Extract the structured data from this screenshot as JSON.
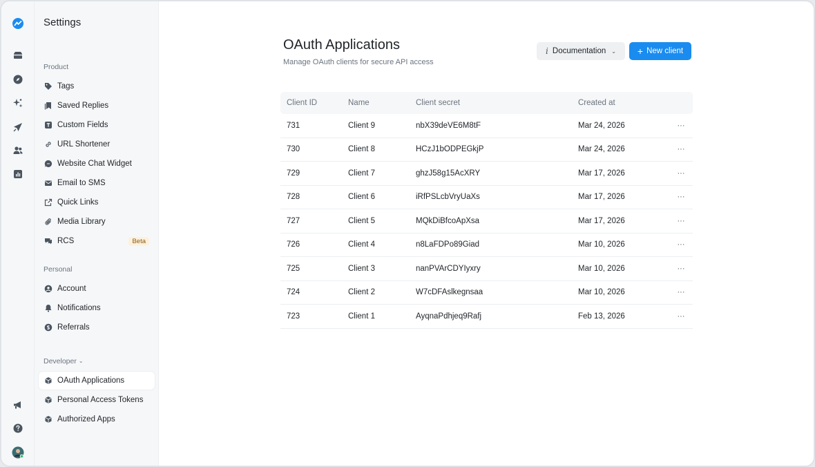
{
  "sidebar": {
    "title": "Settings",
    "sections": {
      "product": "Product",
      "personal": "Personal",
      "developer": "Developer"
    },
    "items": {
      "tags": "Tags",
      "saved_replies": "Saved Replies",
      "custom_fields": "Custom Fields",
      "url_shortener": "URL Shortener",
      "website_chat_widget": "Website Chat Widget",
      "email_to_sms": "Email to SMS",
      "quick_links": "Quick Links",
      "media_library": "Media Library",
      "rcs": "RCS",
      "rcs_badge": "Beta",
      "account": "Account",
      "notifications": "Notifications",
      "referrals": "Referrals",
      "oauth_applications": "OAuth Applications",
      "personal_access_tokens": "Personal Access Tokens",
      "authorized_apps": "Authorized Apps"
    },
    "active_item": "oauth_applications"
  },
  "rail": {
    "icons": [
      "logo-icon",
      "inbox-icon",
      "compass-icon",
      "sparkles-icon",
      "send-icon",
      "contacts-icon",
      "analytics-icon",
      "megaphone-icon",
      "help-icon",
      "avatar"
    ]
  },
  "header": {
    "title": "OAuth Applications",
    "subtitle": "Manage OAuth clients for secure API access",
    "doc_button": "Documentation",
    "new_button": "New client"
  },
  "table": {
    "columns": {
      "id": "Client ID",
      "name": "Name",
      "secret": "Client secret",
      "created": "Created at"
    },
    "rows": [
      {
        "id": "731",
        "name": "Client 9",
        "secret": "nbX39deVE6M8tF",
        "created": "Mar 24, 2026"
      },
      {
        "id": "730",
        "name": "Client 8",
        "secret": "HCzJ1bODPEGkjP",
        "created": "Mar 24, 2026"
      },
      {
        "id": "729",
        "name": "Client 7",
        "secret": "ghzJ58g15AcXRY",
        "created": "Mar 17, 2026"
      },
      {
        "id": "728",
        "name": "Client 6",
        "secret": "iRfPSLcbVryUaXs",
        "created": "Mar 17, 2026"
      },
      {
        "id": "727",
        "name": "Client 5",
        "secret": "MQkDiBfcoApXsa",
        "created": "Mar 17, 2026"
      },
      {
        "id": "726",
        "name": "Client 4",
        "secret": "n8LaFDPo89Giad",
        "created": "Mar 10, 2026"
      },
      {
        "id": "725",
        "name": "Client 3",
        "secret": "nanPVArCDYIyxry",
        "created": "Mar 10, 2026"
      },
      {
        "id": "724",
        "name": "Client 2",
        "secret": "W7cDFAslkegnsaa",
        "created": "Mar 10, 2026"
      },
      {
        "id": "723",
        "name": "Client 1",
        "secret": "AyqnaPdhjeq9Rafj",
        "created": "Feb 13, 2026"
      }
    ],
    "more_glyph": "···"
  },
  "colors": {
    "accent": "#1a8cf0",
    "sidebar_bg": "#f6f7f8",
    "badge_bg": "#fdf1dc"
  }
}
